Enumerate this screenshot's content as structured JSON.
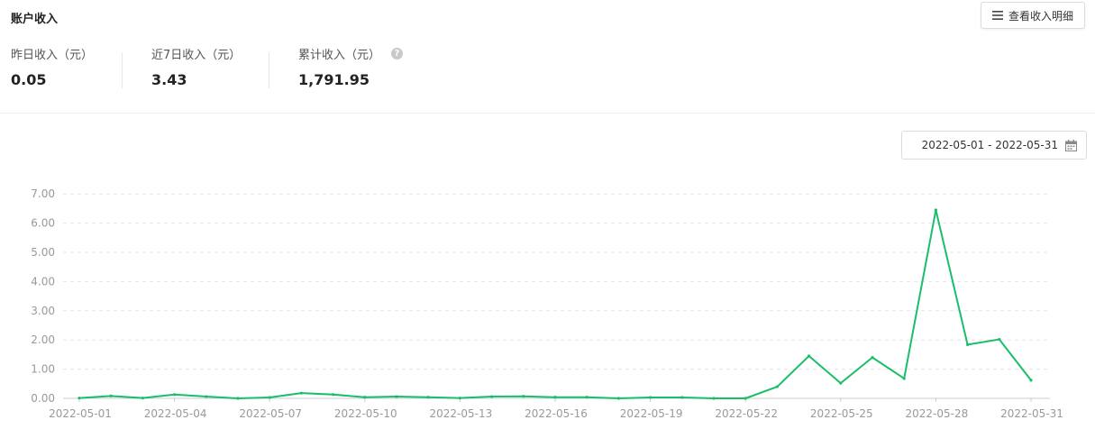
{
  "header": {
    "title": "账户收入",
    "detail_button": "查看收入明细",
    "detail_icon": "menu-icon"
  },
  "stats": [
    {
      "label": "昨日收入（元）",
      "value": "0.05"
    },
    {
      "label": "近7日收入（元）",
      "value": "3.43"
    },
    {
      "label": "累计收入（元）",
      "value": "1,791.95",
      "help_icon": "?"
    }
  ],
  "date_range": {
    "value": "2022-05-01 - 2022-05-31",
    "icon": "calendar-icon"
  },
  "colors": {
    "line": "#19be6b",
    "grid": "#e5e5e5",
    "tick_text": "#999999"
  },
  "chart_data": {
    "type": "line",
    "title": "",
    "xlabel": "",
    "ylabel": "",
    "ylim": [
      0,
      7
    ],
    "yticks": [
      "0.00",
      "1.00",
      "2.00",
      "3.00",
      "4.00",
      "5.00",
      "6.00",
      "7.00"
    ],
    "xtick_labels": [
      "2022-05-01",
      "2022-05-04",
      "2022-05-07",
      "2022-05-10",
      "2022-05-13",
      "2022-05-16",
      "2022-05-19",
      "2022-05-22",
      "2022-05-25",
      "2022-05-28",
      "2022-05-31"
    ],
    "grid": true,
    "x": [
      "2022-05-01",
      "2022-05-02",
      "2022-05-03",
      "2022-05-04",
      "2022-05-05",
      "2022-05-06",
      "2022-05-07",
      "2022-05-08",
      "2022-05-09",
      "2022-05-10",
      "2022-05-11",
      "2022-05-12",
      "2022-05-13",
      "2022-05-14",
      "2022-05-15",
      "2022-05-16",
      "2022-05-17",
      "2022-05-18",
      "2022-05-19",
      "2022-05-20",
      "2022-05-21",
      "2022-05-22",
      "2022-05-23",
      "2022-05-24",
      "2022-05-25",
      "2022-05-26",
      "2022-05-27",
      "2022-05-28",
      "2022-05-29",
      "2022-05-30",
      "2022-05-31"
    ],
    "series": [
      {
        "values": [
          0.01,
          0.08,
          0.01,
          0.13,
          0.06,
          0.0,
          0.03,
          0.18,
          0.13,
          0.04,
          0.06,
          0.04,
          0.01,
          0.06,
          0.07,
          0.04,
          0.04,
          0.0,
          0.03,
          0.03,
          0.0,
          0.0,
          0.4,
          1.45,
          0.52,
          1.4,
          0.68,
          6.45,
          1.84,
          2.02,
          0.62
        ]
      }
    ]
  }
}
